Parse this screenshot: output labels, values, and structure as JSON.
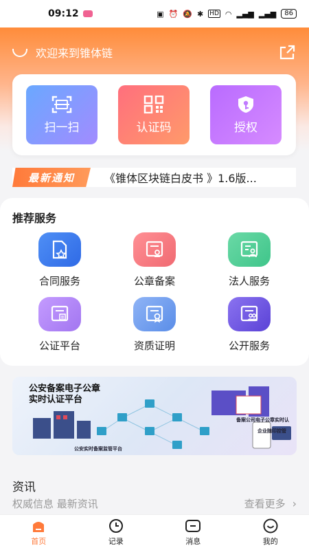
{
  "status_bar": {
    "time": "09:12",
    "battery": "86",
    "hd": "HD"
  },
  "header": {
    "welcome": "欢迎来到锥体链"
  },
  "quick_actions": [
    {
      "label": "扫一扫",
      "icon": "scan-icon"
    },
    {
      "label": "认证码",
      "icon": "qr-code-icon"
    },
    {
      "label": "授权",
      "icon": "shield-key-icon"
    }
  ],
  "notice": {
    "tag": "最新通知",
    "text": "《锥体区块链白皮书 》1.6版..."
  },
  "services": {
    "title": "推荐服务",
    "items": [
      {
        "label": "合同服务",
        "icon": "contract-icon",
        "color": "#3c7cf0"
      },
      {
        "label": "公章备案",
        "icon": "seal-icon",
        "color": "#f06a72"
      },
      {
        "label": "法人服务",
        "icon": "legal-person-icon",
        "color": "#3fc58a"
      },
      {
        "label": "公证平台",
        "icon": "notary-icon",
        "color": "#a276f0"
      },
      {
        "label": "资质证明",
        "icon": "certificate-icon",
        "color": "#5a8de8"
      },
      {
        "label": "公开服务",
        "icon": "public-service-icon",
        "color": "#6a52e0"
      }
    ]
  },
  "banner": {
    "title_line1": "公安备案电子公章",
    "title_line2": "实时认证平台",
    "caption_bottom": "公安实时备案监管平台",
    "caption_right": "备案公司电子公章实时认",
    "caption_right2": "企业随印控管"
  },
  "news": {
    "title": "资讯",
    "subtitle": "权威信息 最新资讯",
    "more": "查看更多"
  },
  "tabbar": [
    {
      "label": "首页",
      "icon": "home-icon",
      "active": true
    },
    {
      "label": "记录",
      "icon": "clock-icon",
      "active": false
    },
    {
      "label": "消息",
      "icon": "message-icon",
      "active": false
    },
    {
      "label": "我的",
      "icon": "profile-icon",
      "active": false
    }
  ],
  "colors": {
    "accent": "#ff7a3a",
    "hero_top": "#ff8c3a"
  }
}
